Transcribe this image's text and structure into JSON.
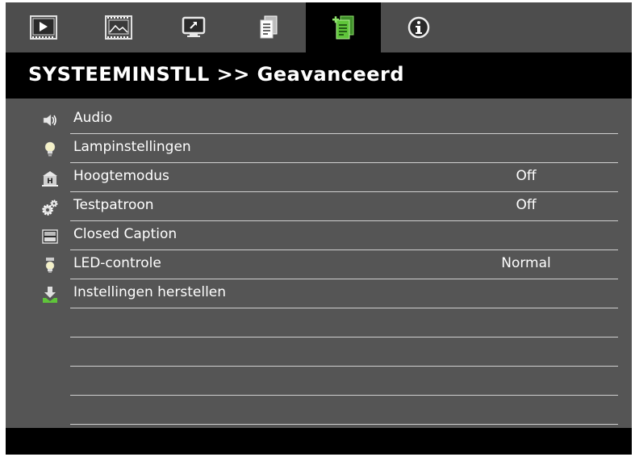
{
  "tabs": [
    {
      "name": "tab-play",
      "icon": "play-icon",
      "active": false
    },
    {
      "name": "tab-image",
      "icon": "picture-icon",
      "active": false
    },
    {
      "name": "tab-display",
      "icon": "display-icon",
      "active": false
    },
    {
      "name": "tab-setup",
      "icon": "document-icon",
      "active": false
    },
    {
      "name": "tab-system-settings",
      "icon": "document-plus-icon",
      "active": true
    },
    {
      "name": "tab-info",
      "icon": "info-icon",
      "active": false
    }
  ],
  "header": {
    "title": "SYSTEEMINSTLL >> Geavanceerd"
  },
  "menu": {
    "items": [
      {
        "label": "Audio",
        "value": "",
        "icon": "speaker-icon"
      },
      {
        "label": "Lampinstellingen",
        "value": "",
        "icon": "lightbulb-icon"
      },
      {
        "label": "Hoogtemodus",
        "value": "Off",
        "icon": "high-altitude-icon"
      },
      {
        "label": "Testpatroon",
        "value": "Off",
        "icon": "gears-icon"
      },
      {
        "label": "Closed Caption",
        "value": "",
        "icon": "text-caption-icon"
      },
      {
        "label": "LED-controle",
        "value": "Normal",
        "icon": "led-bulb-icon"
      },
      {
        "label": "Instellingen herstellen",
        "value": "",
        "icon": "reset-download-icon"
      }
    ],
    "empty_rows": 4
  },
  "colors": {
    "panel_bg": "#555555",
    "tabbar_bg": "#4d4d4d",
    "active_tab": "#000000",
    "title_bg": "#000000",
    "text": "#ffffff",
    "separator": "#d0d0d0",
    "active_icon_green": "#5fc53a"
  }
}
